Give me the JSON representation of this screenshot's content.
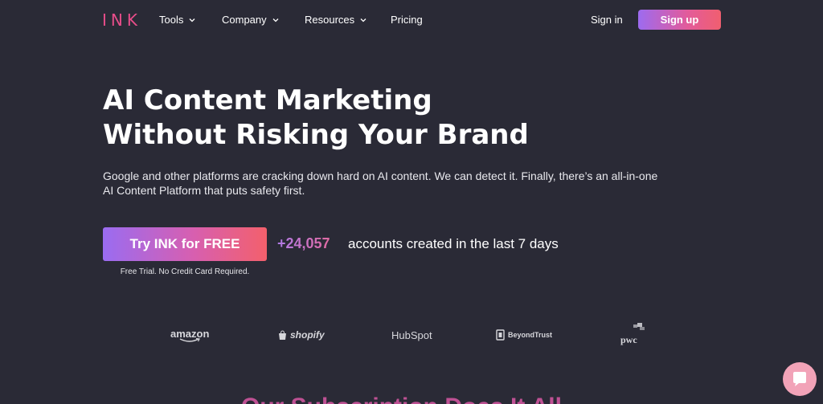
{
  "nav": {
    "logo": "INK",
    "items": [
      {
        "label": "Tools",
        "dropdown": true
      },
      {
        "label": "Company",
        "dropdown": true
      },
      {
        "label": "Resources",
        "dropdown": true
      },
      {
        "label": "Pricing",
        "dropdown": false
      }
    ],
    "signin_label": "Sign in",
    "signup_label": "Sign up"
  },
  "hero": {
    "title_line1": "AI Content Marketing",
    "title_line2": "Without Risking Your Brand",
    "description": "Google and other platforms are cracking down hard on AI content. We can detect it. Finally, there’s an all-in-one AI Content Platform that puts safety first.",
    "cta_label": "Try INK for FREE",
    "cta_note": "Free Trial. No Credit Card Required.",
    "accounts_count": "+24,057",
    "accounts_text": "accounts created in the last 7 days"
  },
  "brands": [
    "amazon",
    "shopify",
    "HubSpot",
    "BeyondTrust",
    "pwc"
  ],
  "bottom": {
    "partial_heading": "Our Subscription Does It All"
  },
  "colors": {
    "background": "#2a2a36",
    "accent_pink": "#e84d8a",
    "accent_purple": "#9d6bf0",
    "accent_coral": "#f05f6f"
  },
  "icons": {
    "chevron": "chevron-down-icon",
    "chat": "chat-bubble-icon"
  }
}
